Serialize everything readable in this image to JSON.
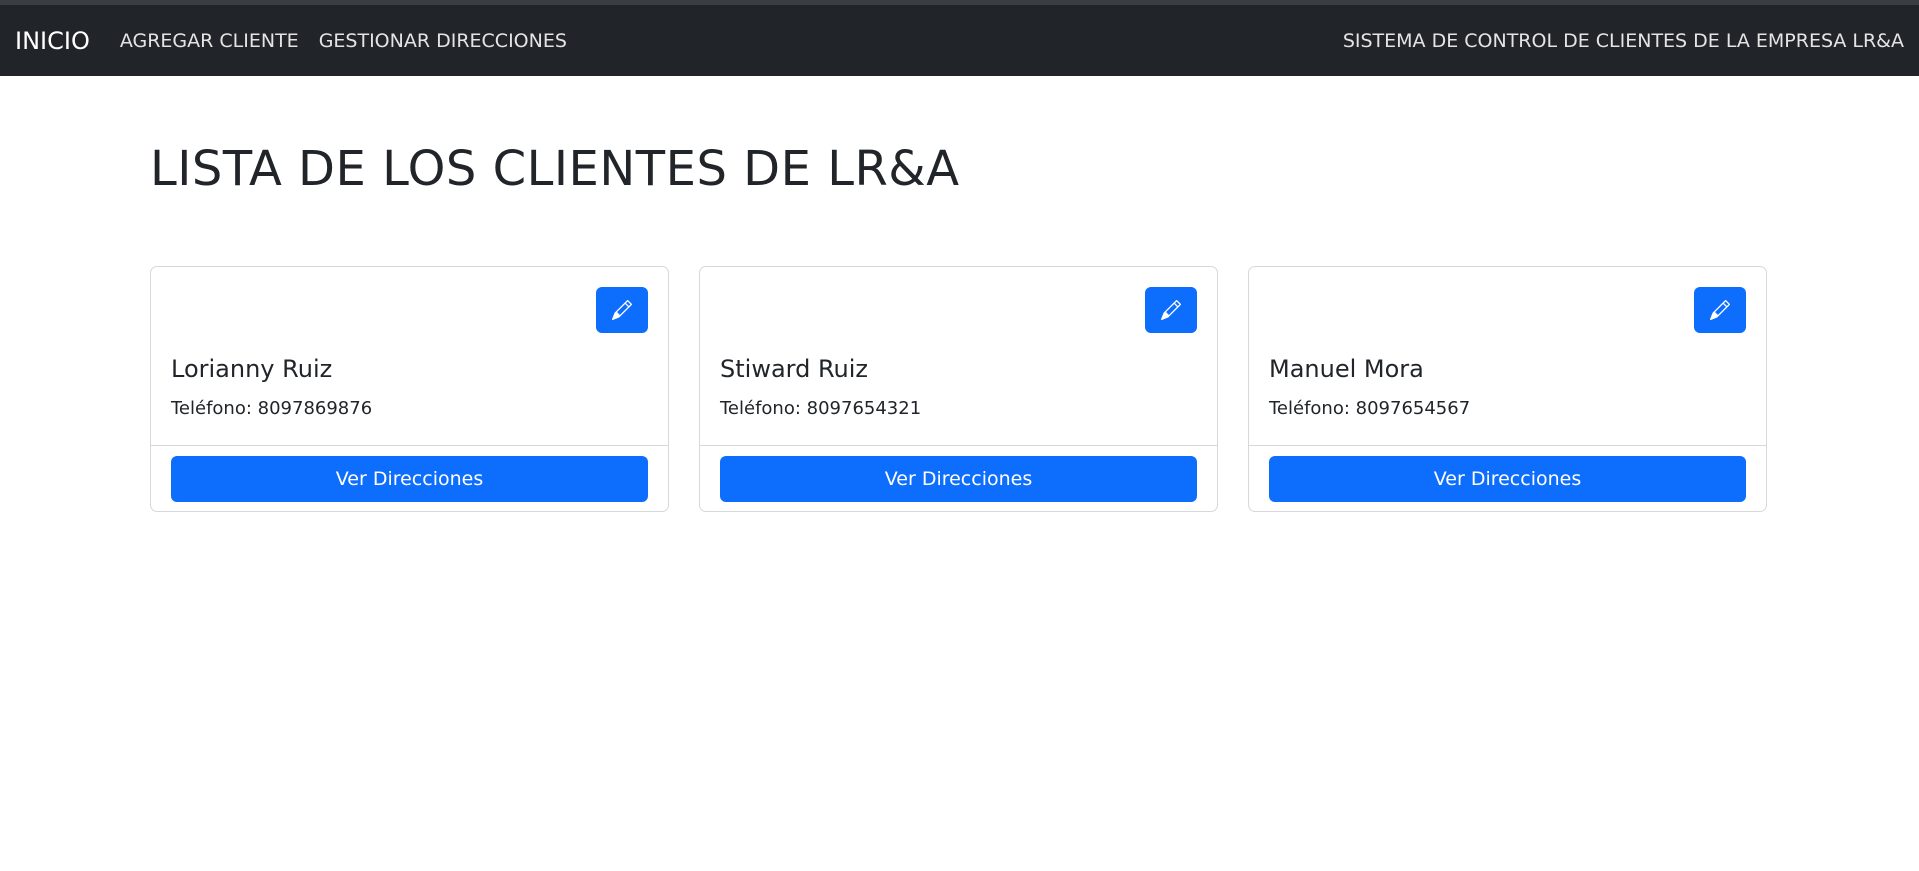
{
  "navbar": {
    "brand": "INICIO",
    "links": [
      "AGREGAR CLIENTE",
      "GESTIONAR DIRECCIONES"
    ],
    "right_text": "SISTEMA DE CONTROL DE CLIENTES DE LA EMPRESA LR&A",
    "background": "#212529"
  },
  "page": {
    "title": "LISTA DE LOS CLIENTES DE LR&A"
  },
  "clients": [
    {
      "name": "Lorianny Ruiz",
      "phone": "Teléfono: 8097869876",
      "button": "Ver Direcciones",
      "edit_icon": "pencil-icon"
    },
    {
      "name": "Stiward Ruiz",
      "phone": "Teléfono: 8097654321",
      "button": "Ver Direcciones",
      "edit_icon": "pencil-icon"
    },
    {
      "name": "Manuel Mora",
      "phone": "Teléfono: 8097654567",
      "button": "Ver Direcciones",
      "edit_icon": "pencil-icon"
    }
  ],
  "colors": {
    "primary": "#0d6efd",
    "text": "#212529",
    "border": "#d6d8db"
  }
}
